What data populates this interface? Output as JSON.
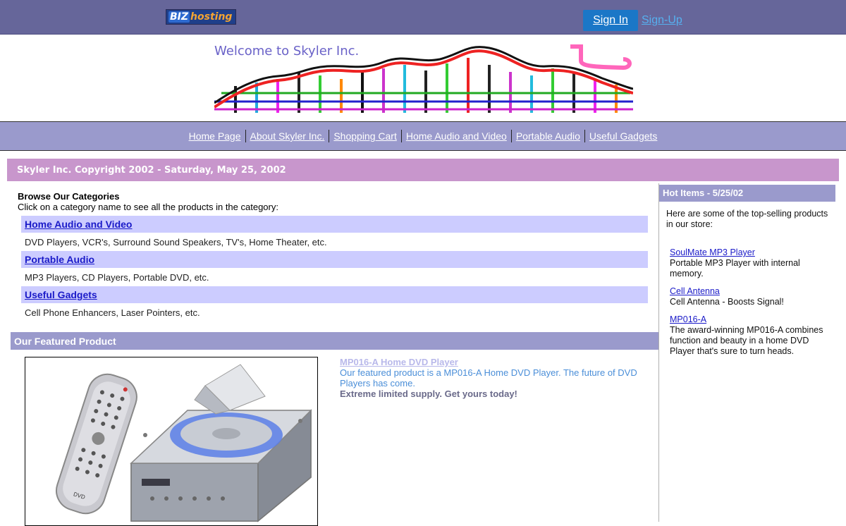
{
  "header": {
    "logo_biz": "BIZ",
    "logo_hosting": "hosting",
    "signin_label": "Sign In",
    "signup_label": "Sign-Up"
  },
  "banner": {
    "welcome": "Welcome to Skyler Inc."
  },
  "nav": {
    "items": [
      {
        "label": "Home Page"
      },
      {
        "label": "About Skyler Inc."
      },
      {
        "label": "Shopping Cart"
      },
      {
        "label": "Home Audio and Video"
      },
      {
        "label": "Portable Audio"
      },
      {
        "label": "Useful Gadgets"
      }
    ]
  },
  "copyright": "Skyler Inc. Copyright 2002 - Saturday, May 25, 2002",
  "browse": {
    "title": "Browse Our Categories",
    "subtitle": "Click on a category name to see all the products in the category:",
    "categories": [
      {
        "name": "Home Audio and Video",
        "desc": "DVD Players, VCR's, Surround Sound Speakers, TV's, Home Theater, etc."
      },
      {
        "name": "Portable Audio",
        "desc": "MP3 Players, CD Players, Portable DVD, etc."
      },
      {
        "name": "Useful Gadgets",
        "desc": "Cell Phone Enhancers, Laser Pointers, etc."
      }
    ]
  },
  "featured": {
    "heading": "Our Featured Product",
    "link": "MP016-A Home DVD Player",
    "desc": "Our featured product is a MP016-A Home DVD Player. The future of DVD Players has come.",
    "supply": "Extreme limited supply. Get yours today!",
    "remote_label": "DVD"
  },
  "hot": {
    "heading": "Hot Items - 5/25/02",
    "intro": "Here are some of the top-selling products in our store:",
    "items": [
      {
        "name": "SoulMate MP3 Player",
        "desc": "Portable MP3 Player with internal memory."
      },
      {
        "name": "Cell Antenna",
        "desc": "Cell Antenna - Boosts Signal!"
      },
      {
        "name": "MP016-A",
        "desc": "The award-winning MP016-A combines function and beauty in a home DVD Player that's sure to turn heads."
      }
    ]
  },
  "colors": {
    "topbar": "#66669a",
    "nav": "#9a9acc",
    "copyright_bar": "#c896cc",
    "category_bar": "#ccccff",
    "signin_button": "#1b77c7"
  }
}
